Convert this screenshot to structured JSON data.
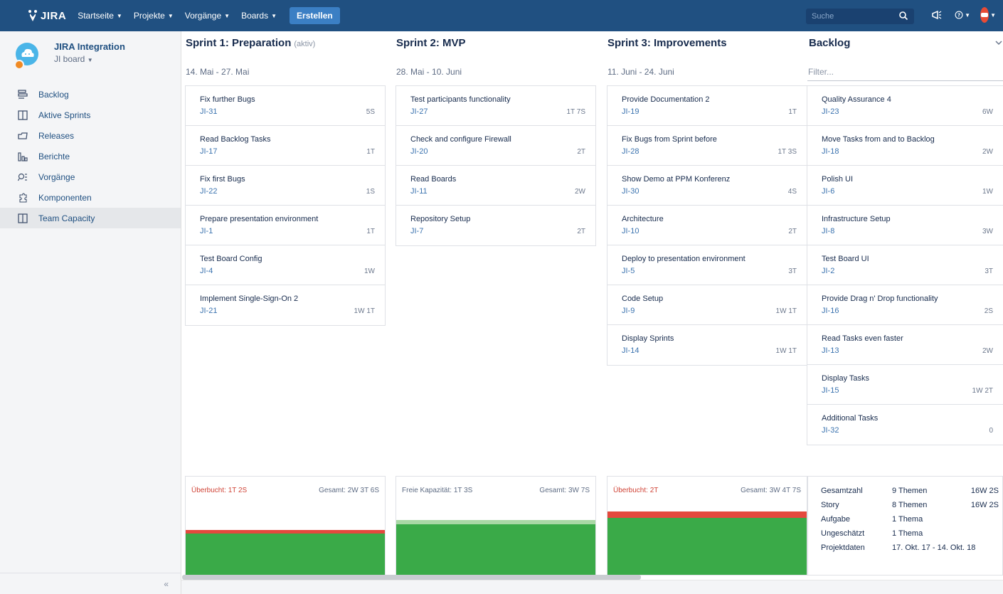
{
  "topbar": {
    "logo_text": "JIRA",
    "nav": [
      {
        "label": "Startseite"
      },
      {
        "label": "Projekte"
      },
      {
        "label": "Vorgänge"
      },
      {
        "label": "Boards"
      }
    ],
    "create_label": "Erstellen",
    "search_placeholder": "Suche",
    "icons": [
      "search-icon",
      "megaphone-icon",
      "help-icon",
      "user-avatar"
    ]
  },
  "sidebar": {
    "project_name": "JIRA Integration",
    "board_name": "JI board",
    "items": [
      {
        "label": "Backlog",
        "icon": "backlog-icon"
      },
      {
        "label": "Aktive Sprints",
        "icon": "sprints-icon"
      },
      {
        "label": "Releases",
        "icon": "releases-icon"
      },
      {
        "label": "Berichte",
        "icon": "reports-icon"
      },
      {
        "label": "Vorgänge",
        "icon": "issues-icon"
      },
      {
        "label": "Komponenten",
        "icon": "components-icon"
      },
      {
        "label": "Team Capacity",
        "icon": "capacity-icon"
      }
    ],
    "collapse_label": "«"
  },
  "columns": [
    {
      "title": "Sprint 1: Preparation",
      "status": "(aktiv)",
      "dates": "14. Mai - 27. Mai",
      "cards": [
        {
          "title": "Fix further Bugs",
          "key": "JI-31",
          "estimate": "5S"
        },
        {
          "title": "Read Backlog Tasks",
          "key": "JI-17",
          "estimate": "1T"
        },
        {
          "title": "Fix first Bugs",
          "key": "JI-22",
          "estimate": "1S"
        },
        {
          "title": "Prepare presentation environment",
          "key": "JI-1",
          "estimate": "1T"
        },
        {
          "title": "Test Board Config",
          "key": "JI-4",
          "estimate": "1W"
        },
        {
          "title": "Implement Single-Sign-On 2",
          "key": "JI-21",
          "estimate": "1W 1T"
        }
      ],
      "capacity": {
        "left": "Überbucht: 1T 2S",
        "left_over": true,
        "right": "Gesamt: 2W 3T 6S"
      }
    },
    {
      "title": "Sprint 2: MVP",
      "status": "",
      "dates": "28. Mai - 10. Juni",
      "cards": [
        {
          "title": "Test participants functionality",
          "key": "JI-27",
          "estimate": "1T 7S"
        },
        {
          "title": "Check and configure Firewall",
          "key": "JI-20",
          "estimate": "2T"
        },
        {
          "title": "Read Boards",
          "key": "JI-11",
          "estimate": "2W"
        },
        {
          "title": "Repository Setup",
          "key": "JI-7",
          "estimate": "2T"
        }
      ],
      "capacity": {
        "left": "Freie Kapazität: 1T 3S",
        "left_over": false,
        "right": "Gesamt: 3W 7S"
      }
    },
    {
      "title": "Sprint 3: Improvements",
      "status": "",
      "dates": "11. Juni - 24. Juni",
      "cards": [
        {
          "title": "Provide Documentation 2",
          "key": "JI-19",
          "estimate": "1T"
        },
        {
          "title": "Fix Bugs from Sprint before",
          "key": "JI-28",
          "estimate": "1T 3S"
        },
        {
          "title": "Show Demo at PPM Konferenz",
          "key": "JI-30",
          "estimate": "4S"
        },
        {
          "title": "Architecture",
          "key": "JI-10",
          "estimate": "2T"
        },
        {
          "title": "Deploy to presentation environment",
          "key": "JI-5",
          "estimate": "3T"
        },
        {
          "title": "Code Setup",
          "key": "JI-9",
          "estimate": "1W 1T"
        },
        {
          "title": "Display Sprints",
          "key": "JI-14",
          "estimate": "1W 1T"
        }
      ],
      "capacity": {
        "left": "Überbucht: 2T",
        "left_over": true,
        "right": "Gesamt: 3W 4T 7S"
      }
    },
    {
      "title": "Backlog",
      "status": "",
      "dates": "",
      "cards": [
        {
          "title": "Quality Assurance 4",
          "key": "JI-23",
          "estimate": "6W"
        },
        {
          "title": "Move Tasks from and to Backlog",
          "key": "JI-18",
          "estimate": "2W"
        },
        {
          "title": "Polish UI",
          "key": "JI-6",
          "estimate": "1W"
        },
        {
          "title": "Infrastructure Setup",
          "key": "JI-8",
          "estimate": "3W"
        },
        {
          "title": "Test Board UI",
          "key": "JI-2",
          "estimate": "3T"
        },
        {
          "title": "Provide Drag n' Drop functionality",
          "key": "JI-16",
          "estimate": "2S"
        },
        {
          "title": "Read Tasks even faster",
          "key": "JI-13",
          "estimate": "2W"
        },
        {
          "title": "Display Tasks",
          "key": "JI-15",
          "estimate": "1W 2T"
        },
        {
          "title": "Additional Tasks",
          "key": "JI-32",
          "estimate": "0"
        }
      ]
    }
  ],
  "backlog": {
    "filter_placeholder": "Filter...",
    "stats": [
      {
        "label": "Gesamtzahl",
        "value": "9 Themen",
        "sum": "16W 2S"
      },
      {
        "label": "Story",
        "value": "8 Themen",
        "sum": "16W 2S"
      },
      {
        "label": "Aufgabe",
        "value": "1 Thema",
        "sum": ""
      },
      {
        "label": "Ungeschätzt",
        "value": "1 Thema",
        "sum": ""
      },
      {
        "label": "Projektdaten",
        "value": "17. Okt. 17 - 14. Okt. 18",
        "sum": ""
      }
    ]
  },
  "colors": {
    "nav": "#205081",
    "link": "#3b73af",
    "over": "#d04437",
    "capacity_green": "#3aaa48",
    "capacity_red": "#e4493d"
  }
}
